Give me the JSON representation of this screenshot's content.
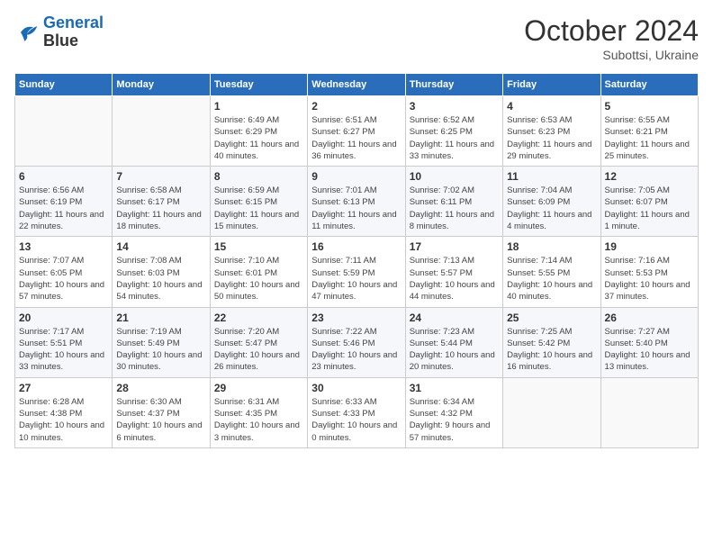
{
  "logo": {
    "line1": "General",
    "line2": "Blue"
  },
  "title": "October 2024",
  "subtitle": "Subottsi, Ukraine",
  "days_of_week": [
    "Sunday",
    "Monday",
    "Tuesday",
    "Wednesday",
    "Thursday",
    "Friday",
    "Saturday"
  ],
  "weeks": [
    [
      {
        "day": "",
        "empty": true
      },
      {
        "day": "",
        "empty": true
      },
      {
        "day": "1",
        "sunrise": "Sunrise: 6:49 AM",
        "sunset": "Sunset: 6:29 PM",
        "daylight": "Daylight: 11 hours and 40 minutes."
      },
      {
        "day": "2",
        "sunrise": "Sunrise: 6:51 AM",
        "sunset": "Sunset: 6:27 PM",
        "daylight": "Daylight: 11 hours and 36 minutes."
      },
      {
        "day": "3",
        "sunrise": "Sunrise: 6:52 AM",
        "sunset": "Sunset: 6:25 PM",
        "daylight": "Daylight: 11 hours and 33 minutes."
      },
      {
        "day": "4",
        "sunrise": "Sunrise: 6:53 AM",
        "sunset": "Sunset: 6:23 PM",
        "daylight": "Daylight: 11 hours and 29 minutes."
      },
      {
        "day": "5",
        "sunrise": "Sunrise: 6:55 AM",
        "sunset": "Sunset: 6:21 PM",
        "daylight": "Daylight: 11 hours and 25 minutes."
      }
    ],
    [
      {
        "day": "6",
        "sunrise": "Sunrise: 6:56 AM",
        "sunset": "Sunset: 6:19 PM",
        "daylight": "Daylight: 11 hours and 22 minutes."
      },
      {
        "day": "7",
        "sunrise": "Sunrise: 6:58 AM",
        "sunset": "Sunset: 6:17 PM",
        "daylight": "Daylight: 11 hours and 18 minutes."
      },
      {
        "day": "8",
        "sunrise": "Sunrise: 6:59 AM",
        "sunset": "Sunset: 6:15 PM",
        "daylight": "Daylight: 11 hours and 15 minutes."
      },
      {
        "day": "9",
        "sunrise": "Sunrise: 7:01 AM",
        "sunset": "Sunset: 6:13 PM",
        "daylight": "Daylight: 11 hours and 11 minutes."
      },
      {
        "day": "10",
        "sunrise": "Sunrise: 7:02 AM",
        "sunset": "Sunset: 6:11 PM",
        "daylight": "Daylight: 11 hours and 8 minutes."
      },
      {
        "day": "11",
        "sunrise": "Sunrise: 7:04 AM",
        "sunset": "Sunset: 6:09 PM",
        "daylight": "Daylight: 11 hours and 4 minutes."
      },
      {
        "day": "12",
        "sunrise": "Sunrise: 7:05 AM",
        "sunset": "Sunset: 6:07 PM",
        "daylight": "Daylight: 11 hours and 1 minute."
      }
    ],
    [
      {
        "day": "13",
        "sunrise": "Sunrise: 7:07 AM",
        "sunset": "Sunset: 6:05 PM",
        "daylight": "Daylight: 10 hours and 57 minutes."
      },
      {
        "day": "14",
        "sunrise": "Sunrise: 7:08 AM",
        "sunset": "Sunset: 6:03 PM",
        "daylight": "Daylight: 10 hours and 54 minutes."
      },
      {
        "day": "15",
        "sunrise": "Sunrise: 7:10 AM",
        "sunset": "Sunset: 6:01 PM",
        "daylight": "Daylight: 10 hours and 50 minutes."
      },
      {
        "day": "16",
        "sunrise": "Sunrise: 7:11 AM",
        "sunset": "Sunset: 5:59 PM",
        "daylight": "Daylight: 10 hours and 47 minutes."
      },
      {
        "day": "17",
        "sunrise": "Sunrise: 7:13 AM",
        "sunset": "Sunset: 5:57 PM",
        "daylight": "Daylight: 10 hours and 44 minutes."
      },
      {
        "day": "18",
        "sunrise": "Sunrise: 7:14 AM",
        "sunset": "Sunset: 5:55 PM",
        "daylight": "Daylight: 10 hours and 40 minutes."
      },
      {
        "day": "19",
        "sunrise": "Sunrise: 7:16 AM",
        "sunset": "Sunset: 5:53 PM",
        "daylight": "Daylight: 10 hours and 37 minutes."
      }
    ],
    [
      {
        "day": "20",
        "sunrise": "Sunrise: 7:17 AM",
        "sunset": "Sunset: 5:51 PM",
        "daylight": "Daylight: 10 hours and 33 minutes."
      },
      {
        "day": "21",
        "sunrise": "Sunrise: 7:19 AM",
        "sunset": "Sunset: 5:49 PM",
        "daylight": "Daylight: 10 hours and 30 minutes."
      },
      {
        "day": "22",
        "sunrise": "Sunrise: 7:20 AM",
        "sunset": "Sunset: 5:47 PM",
        "daylight": "Daylight: 10 hours and 26 minutes."
      },
      {
        "day": "23",
        "sunrise": "Sunrise: 7:22 AM",
        "sunset": "Sunset: 5:46 PM",
        "daylight": "Daylight: 10 hours and 23 minutes."
      },
      {
        "day": "24",
        "sunrise": "Sunrise: 7:23 AM",
        "sunset": "Sunset: 5:44 PM",
        "daylight": "Daylight: 10 hours and 20 minutes."
      },
      {
        "day": "25",
        "sunrise": "Sunrise: 7:25 AM",
        "sunset": "Sunset: 5:42 PM",
        "daylight": "Daylight: 10 hours and 16 minutes."
      },
      {
        "day": "26",
        "sunrise": "Sunrise: 7:27 AM",
        "sunset": "Sunset: 5:40 PM",
        "daylight": "Daylight: 10 hours and 13 minutes."
      }
    ],
    [
      {
        "day": "27",
        "sunrise": "Sunrise: 6:28 AM",
        "sunset": "Sunset: 4:38 PM",
        "daylight": "Daylight: 10 hours and 10 minutes."
      },
      {
        "day": "28",
        "sunrise": "Sunrise: 6:30 AM",
        "sunset": "Sunset: 4:37 PM",
        "daylight": "Daylight: 10 hours and 6 minutes."
      },
      {
        "day": "29",
        "sunrise": "Sunrise: 6:31 AM",
        "sunset": "Sunset: 4:35 PM",
        "daylight": "Daylight: 10 hours and 3 minutes."
      },
      {
        "day": "30",
        "sunrise": "Sunrise: 6:33 AM",
        "sunset": "Sunset: 4:33 PM",
        "daylight": "Daylight: 10 hours and 0 minutes."
      },
      {
        "day": "31",
        "sunrise": "Sunrise: 6:34 AM",
        "sunset": "Sunset: 4:32 PM",
        "daylight": "Daylight: 9 hours and 57 minutes."
      },
      {
        "day": "",
        "empty": true
      },
      {
        "day": "",
        "empty": true
      }
    ]
  ]
}
